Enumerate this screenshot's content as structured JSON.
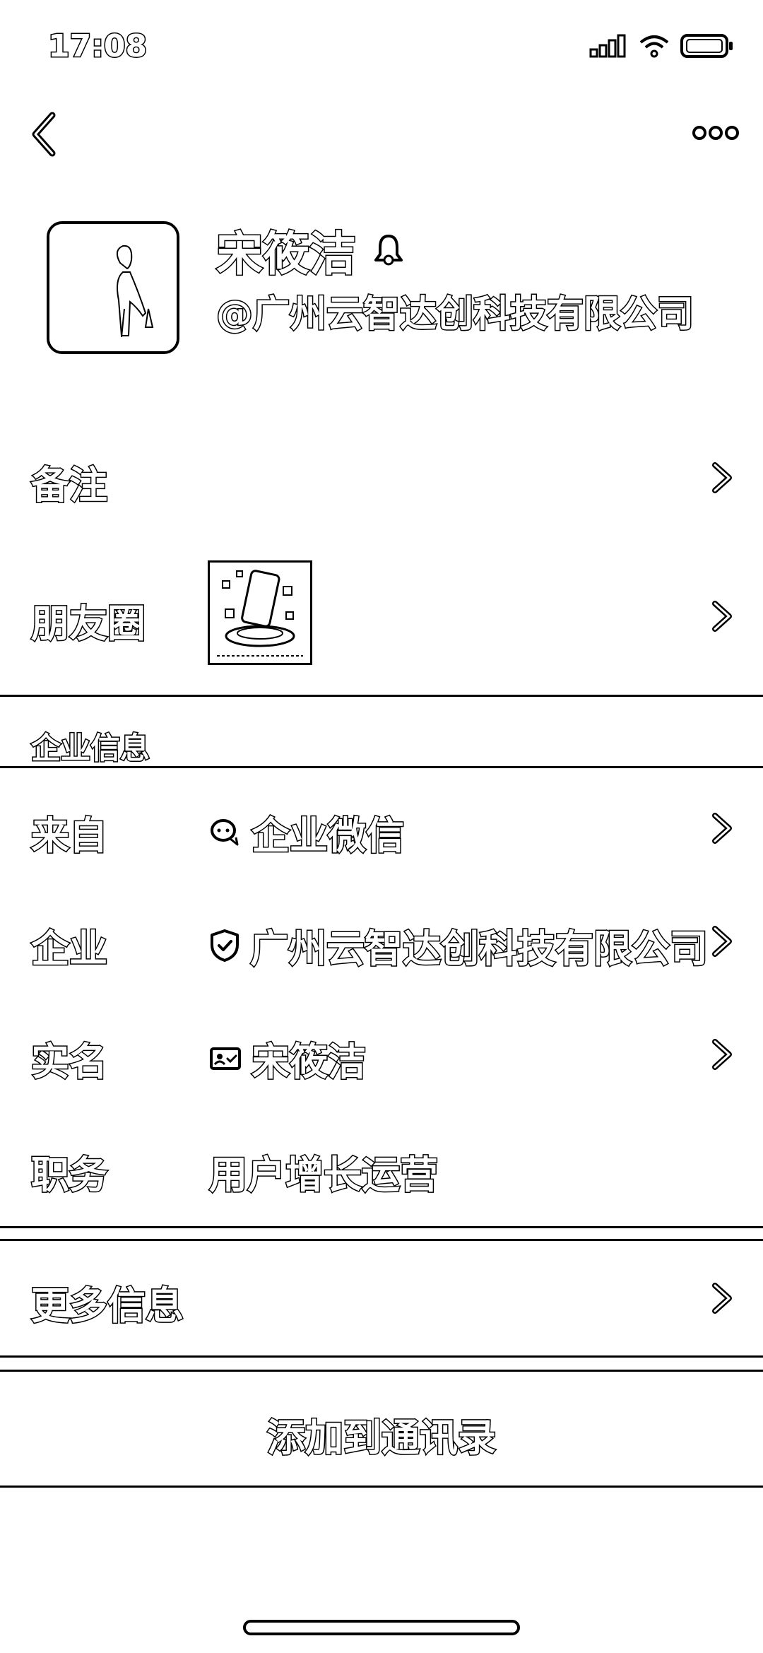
{
  "status_bar": {
    "time": "17:08"
  },
  "profile": {
    "name": "宋筱洁",
    "company_handle": "@广州云智达创科技有限公司"
  },
  "rows": {
    "remark": {
      "label": "备注"
    },
    "moments": {
      "label": "朋友圈"
    }
  },
  "enterprise": {
    "section_title": "企业信息",
    "from": {
      "label": "来自",
      "value": "企业微信"
    },
    "company": {
      "label": "企业",
      "value": "广州云智达创科技有限公司"
    },
    "real_name": {
      "label": "实名",
      "value": "宋筱洁"
    },
    "position": {
      "label": "职务",
      "value": "用户增长运营"
    }
  },
  "more_info": {
    "label": "更多信息"
  },
  "action": {
    "add_to_contacts": "添加到通讯录"
  },
  "icons": {
    "back": "back-chevron-icon",
    "more": "more-dots-icon",
    "bell": "bell-icon",
    "wecom": "wecom-icon",
    "verified": "shield-check-icon",
    "id_card": "id-card-icon"
  }
}
